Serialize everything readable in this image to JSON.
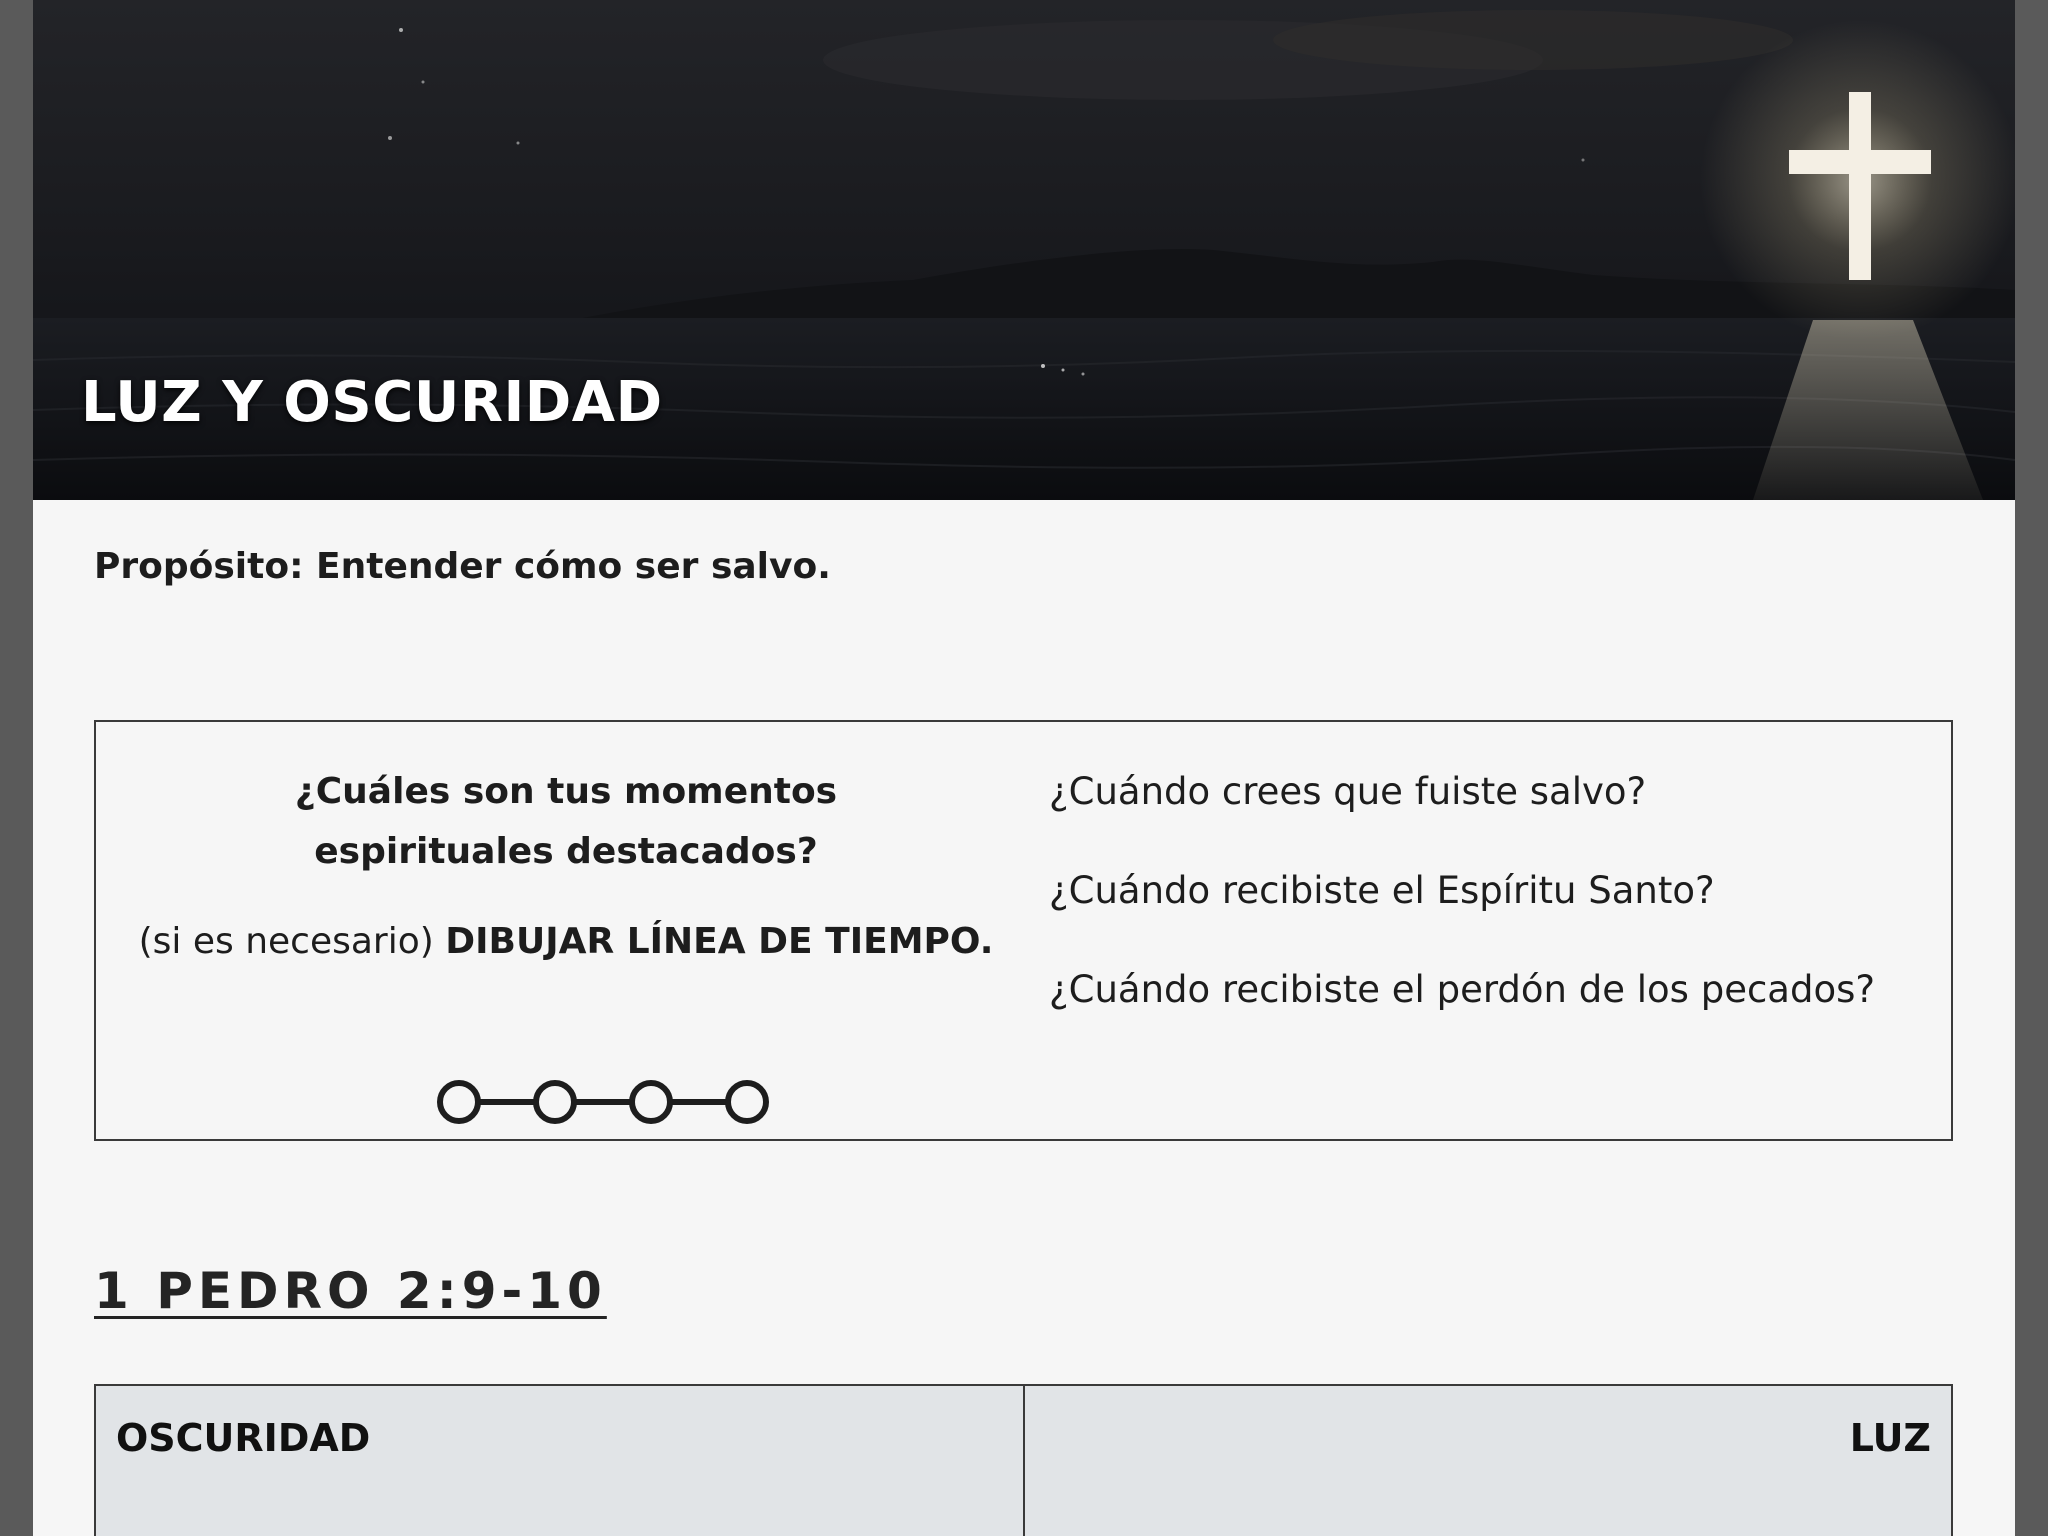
{
  "hero": {
    "title": "LUZ Y OSCURIDAD",
    "image_subject": "night sea with a glowing cross on a hill"
  },
  "purpose": {
    "text": "Propósito: Entender cómo ser salvo."
  },
  "question_box": {
    "heading_line1": "¿Cuáles son tus momentos",
    "heading_line2": "espirituales destacados?",
    "instruction_prefix": "(si es necesario)",
    "instruction_emphasis": "DIBUJAR LÍNEA DE TIEMPO.",
    "timeline_icon": "timeline-icon",
    "questions": [
      "¿Cuándo crees que fuiste salvo?",
      "¿Cuándo recibiste el Espíritu Santo?",
      "¿Cuándo recibiste el perdón de los pecados?"
    ]
  },
  "scripture": {
    "reference": "1 PEDRO 2:9-10"
  },
  "contrast_table": {
    "left_header": "OSCURIDAD",
    "right_header": "LUZ",
    "background_color": "#e1e4e7"
  },
  "colors": {
    "page_background": "#f6f6f6",
    "frame_background": "#5a5a5a",
    "text": "#1d1d1d"
  }
}
